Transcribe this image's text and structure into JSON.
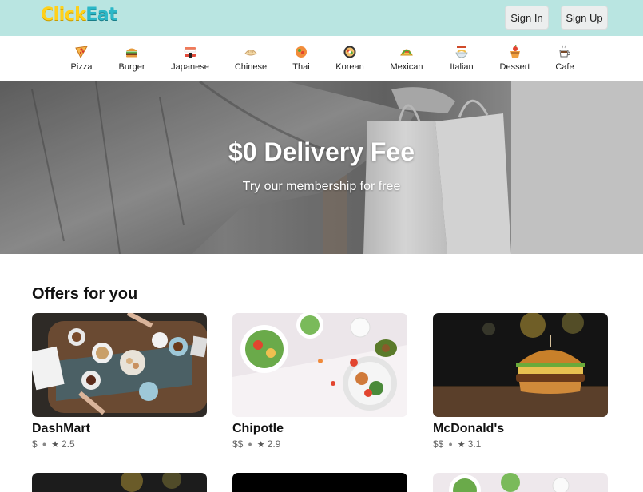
{
  "app": {
    "logo_part1": "Click",
    "logo_part2": "Eat"
  },
  "header": {
    "signin_label": "Sign In",
    "signup_label": "Sign Up"
  },
  "categories": [
    {
      "label": "Pizza",
      "icon": "pizza-icon"
    },
    {
      "label": "Burger",
      "icon": "burger-icon"
    },
    {
      "label": "Japanese",
      "icon": "sushi-icon"
    },
    {
      "label": "Chinese",
      "icon": "dumpling-icon"
    },
    {
      "label": "Thai",
      "icon": "thai-bowl-icon"
    },
    {
      "label": "Korean",
      "icon": "korean-bowl-icon"
    },
    {
      "label": "Mexican",
      "icon": "taco-icon"
    },
    {
      "label": "Italian",
      "icon": "pasta-icon"
    },
    {
      "label": "Dessert",
      "icon": "dessert-icon"
    },
    {
      "label": "Cafe",
      "icon": "coffee-icon"
    }
  ],
  "hero": {
    "title": "$0 Delivery Fee",
    "subtitle": "Try our membership for free"
  },
  "offers": {
    "section_title": "Offers for you",
    "items": [
      {
        "name": "DashMart",
        "price": "$",
        "rating": "2.5"
      },
      {
        "name": "Chipotle",
        "price": "$$",
        "rating": "2.9"
      },
      {
        "name": "McDonald's",
        "price": "$$",
        "rating": "3.1"
      }
    ]
  },
  "colors": {
    "header_bg": "#b9e5e1",
    "logo_yellow": "#ffd11a",
    "logo_teal": "#2bb8c8"
  }
}
